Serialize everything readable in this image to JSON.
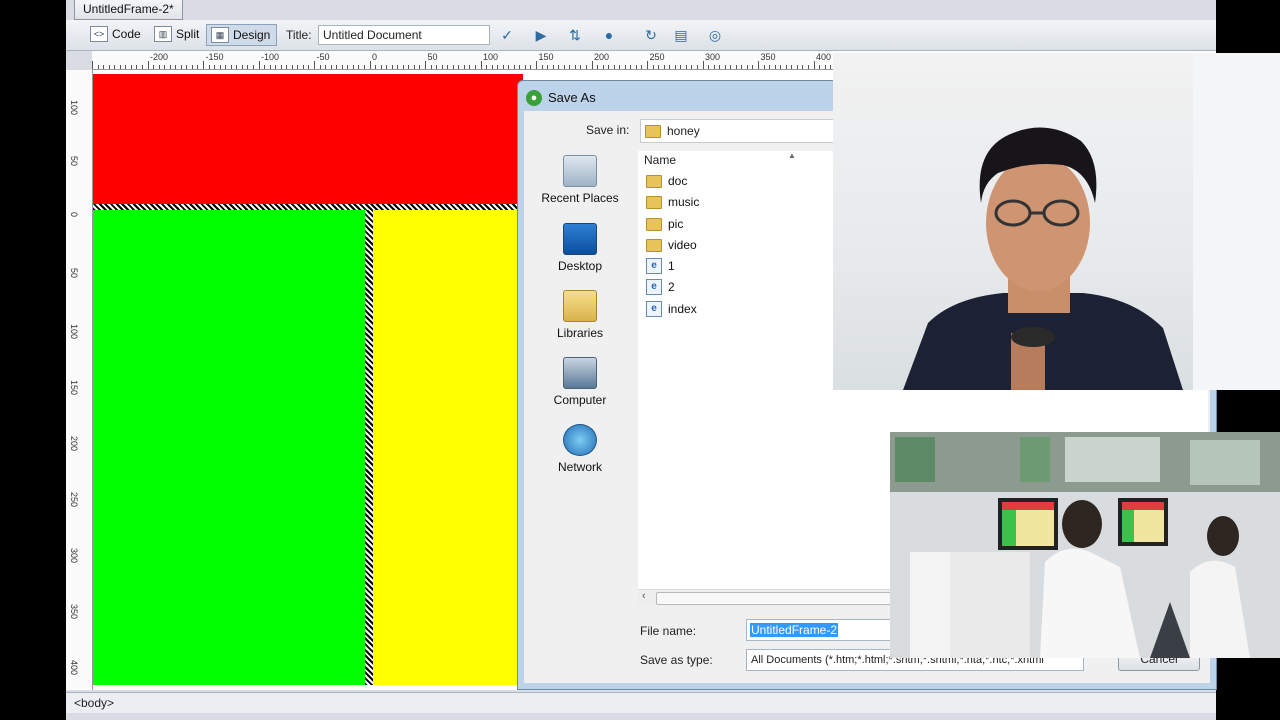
{
  "document_tab": "UntitledFrame-2*",
  "toolbar": {
    "code_label": "Code",
    "split_label": "Split",
    "design_label": "Design",
    "title_label": "Title:",
    "title_value": "Untitled Document"
  },
  "ruler": {
    "top_labels": [
      "-200",
      "-150",
      "-100",
      "-50",
      "0",
      "50",
      "100",
      "150",
      "200",
      "250",
      "300",
      "350",
      "400"
    ],
    "left_labels": [
      "100",
      "50",
      "0",
      "50",
      "100",
      "150",
      "200",
      "250",
      "300",
      "350",
      "400"
    ]
  },
  "status": {
    "tag": "<body>"
  },
  "dialog": {
    "title": "Save As",
    "save_in_label": "Save in:",
    "save_in_value": "honey",
    "places": [
      {
        "label": "Recent Places",
        "icon": "recent-places-icon"
      },
      {
        "label": "Desktop",
        "icon": "desktop-icon"
      },
      {
        "label": "Libraries",
        "icon": "libraries-icon"
      },
      {
        "label": "Computer",
        "icon": "computer-icon"
      },
      {
        "label": "Network",
        "icon": "network-icon"
      }
    ],
    "column_name": "Name",
    "files": [
      {
        "name": "doc",
        "type": "folder"
      },
      {
        "name": "music",
        "type": "folder"
      },
      {
        "name": "pic",
        "type": "folder"
      },
      {
        "name": "video",
        "type": "folder"
      },
      {
        "name": "1",
        "type": "html"
      },
      {
        "name": "2",
        "type": "html"
      },
      {
        "name": "index",
        "type": "html"
      }
    ],
    "file_name_label": "File name:",
    "file_name_value": "UntitledFrame-2",
    "save_type_label": "Save as type:",
    "save_type_value": "All Documents (*.htm;*.html;*.shtm;*.shtml;*.hta;*.htc;*.xhtml",
    "cancel_label": "Cancel"
  },
  "colors": {
    "frame_top": "#ff0000",
    "frame_left": "#00ff00",
    "frame_right": "#ffff00"
  }
}
